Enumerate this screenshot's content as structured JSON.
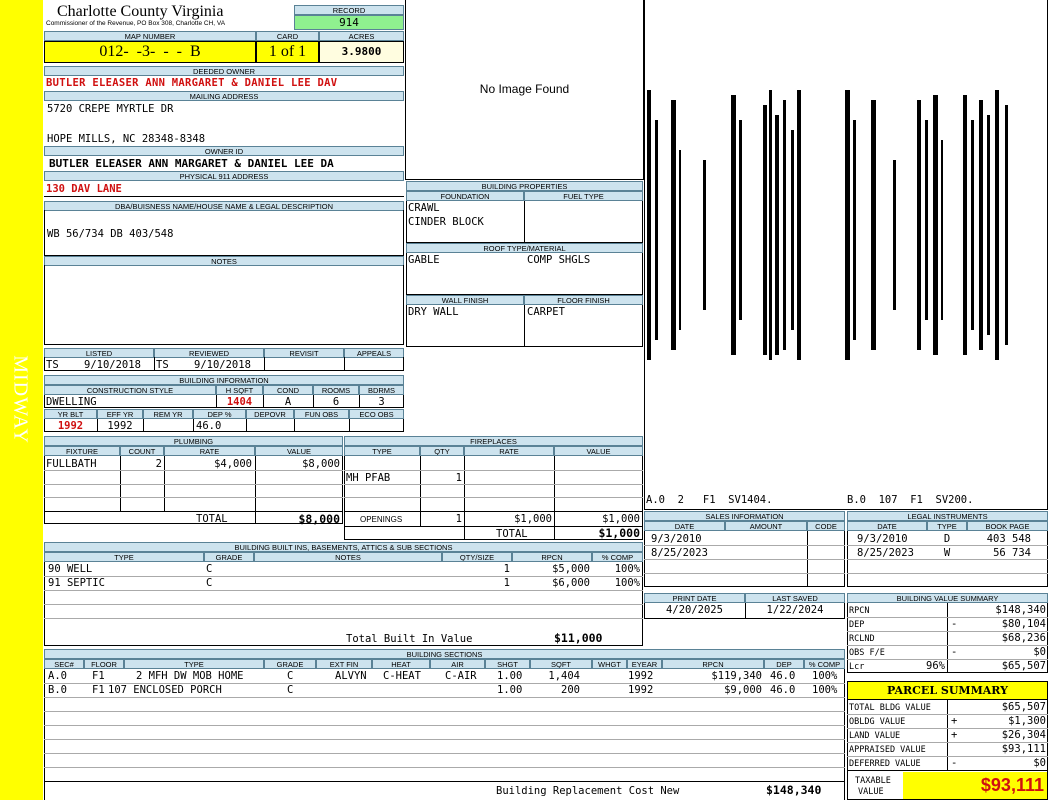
{
  "side_label": "MIDWAY",
  "county": {
    "title": "Charlotte County Virginia",
    "subtitle": "Commissioner of the Revenue, PO Box 308, Charlotte CH, VA"
  },
  "record": {
    "label": "RECORD",
    "value": "914"
  },
  "map": {
    "label": "MAP NUMBER",
    "value": "012-  -3-  -  -  B"
  },
  "card": {
    "label": "CARD",
    "value": "1 of 1"
  },
  "acres": {
    "label": "ACRES",
    "value": "3.9800"
  },
  "owner": {
    "label": "DEEDED OWNER",
    "value": "BUTLER ELEASER ANN MARGARET & DANIEL LEE DAV"
  },
  "mailing": {
    "label": "MAILING ADDRESS",
    "line1": "5720 CREPE MYRTLE DR",
    "line2": "HOPE MILLS, NC 28348-8348"
  },
  "owner_id": {
    "label": "OWNER ID",
    "value": "BUTLER ELEASER ANN MARGARET & DANIEL LEE DA"
  },
  "physical": {
    "label": "PHYSICAL 911 ADDRESS",
    "value": "130 DAV LANE"
  },
  "legal": {
    "label": "DBA/BUISNESS NAME/HOUSE NAME & LEGAL DESCRIPTION",
    "value": "WB 56/734 DB 403/548"
  },
  "notes": {
    "label": "NOTES"
  },
  "status": {
    "listed_label": "LISTED",
    "reviewed_label": "REVIEWED",
    "revisit_label": "REVISIT",
    "appeals_label": "APPEALS",
    "listed_by": "TS",
    "listed_date": "9/10/2018",
    "reviewed_by": "TS",
    "reviewed_date": "9/10/2018"
  },
  "building_info": {
    "label": "BUILDING INFORMATION",
    "h_style": "CONSTRUCTION STYLE",
    "h_sqft": "H SQFT",
    "h_cond": "COND",
    "h_rooms": "ROOMS",
    "h_bdrms": "BDRMS",
    "style": "DWELLING",
    "sqft": "1404",
    "cond": "A",
    "rooms": "6",
    "bdrms": "3",
    "h_yrblt": "YR BLT",
    "h_effyr": "EFF YR",
    "h_remyr": "REM YR",
    "h_dep": "DEP %",
    "h_depovr": "DEPOVR",
    "h_funobs": "FUN OBS",
    "h_ecoobs": "ECO OBS",
    "yrblt": "1992",
    "effyr": "1992",
    "dep": "46.0"
  },
  "photo": {
    "text": "No Image Found"
  },
  "building_props": {
    "label": "BUILDING PROPERTIES",
    "foundation_label": "FOUNDATION",
    "fuel_label": "FUEL TYPE",
    "foundation1": "CRAWL",
    "foundation2": "CINDER BLOCK",
    "roof_label": "ROOF TYPE/MATERIAL",
    "roof_type": "GABLE",
    "roof_mat": "COMP SHGLS",
    "wall_label": "WALL FINISH",
    "floor_label": "FLOOR FINISH",
    "wall": "DRY WALL",
    "floor": "CARPET"
  },
  "sketch": {
    "caption_a": "A.0  2   F1  SV1404.",
    "caption_b": "B.0  107  F1  SV200."
  },
  "plumbing": {
    "label": "PLUMBING",
    "h_fixture": "FIXTURE",
    "h_count": "COUNT",
    "h_rate": "RATE",
    "h_value": "VALUE",
    "fixture": "FULLBATH",
    "count": "2",
    "rate": "$4,000",
    "value": "$8,000",
    "total_label": "TOTAL",
    "total": "$8,000"
  },
  "fireplaces": {
    "label": "FIREPLACES",
    "h_type": "TYPE",
    "h_qty": "QTY",
    "h_rate": "RATE",
    "h_value": "VALUE",
    "type": "MH PFAB",
    "qty": "1",
    "openings_label": "OPENINGS",
    "openings_qty": "1",
    "openings_rate": "$1,000",
    "openings_value": "$1,000",
    "total_label": "TOTAL",
    "total": "$1,000"
  },
  "sales": {
    "label": "SALES INFORMATION",
    "h_date": "DATE",
    "h_amount": "AMOUNT",
    "h_code": "CODE",
    "rows": [
      {
        "date": "9/3/2010"
      },
      {
        "date": "8/25/2023"
      }
    ]
  },
  "instruments": {
    "label": "LEGAL INSTRUMENTS",
    "h_date": "DATE",
    "h_type": "TYPE",
    "h_book": "BOOK PAGE",
    "rows": [
      {
        "date": "9/3/2010",
        "type": "D",
        "book": "403 548"
      },
      {
        "date": "8/25/2023",
        "type": "W",
        "book": "56 734"
      }
    ]
  },
  "builtins": {
    "label": "BUILDING BUILT INS, BASEMENTS, ATTICS & SUB SECTIONS",
    "h_type": "TYPE",
    "h_grade": "GRADE",
    "h_notes": "NOTES",
    "h_qty": "QTY/SIZE",
    "h_rpcn": "RPCN",
    "h_comp": "% COMP",
    "rows": [
      {
        "type": "90 WELL",
        "grade": "C",
        "qty": "1",
        "rpcn": "$5,000",
        "comp": "100%"
      },
      {
        "type": "91 SEPTIC",
        "grade": "C",
        "qty": "1",
        "rpcn": "$6,000",
        "comp": "100%"
      }
    ],
    "total_label": "Total Built In Value",
    "total": "$11,000"
  },
  "dates": {
    "print_label": "PRINT DATE",
    "saved_label": "LAST SAVED",
    "print": "4/20/2025",
    "saved": "1/22/2024"
  },
  "value_summary": {
    "label": "BUILDING VALUE SUMMARY",
    "rpcn_label": "RPCN",
    "rpcn": "$148,340",
    "dep_label": "DEP",
    "dep_sign": "-",
    "dep": "$80,104",
    "rclnd_label": "RCLND",
    "rclnd": "$68,236",
    "obs_label": "OBS F/E",
    "obs_sign": "-",
    "obs": "$0",
    "lcr_label": "Lcr",
    "lcr_pct": "96%",
    "lcr": "$65,507"
  },
  "sections": {
    "label": "BUILDING SECTIONS",
    "h_sec": "SEC#",
    "h_floor": "FLOOR",
    "h_type": "TYPE",
    "h_grade": "GRADE",
    "h_extfin": "EXT FIN",
    "h_heat": "HEAT",
    "h_air": "AIR",
    "h_shgt": "SHGT",
    "h_sqft": "SQFT",
    "h_whgt": "WHGT",
    "h_eyear": "EYEAR",
    "h_rpcn": "RPCN",
    "h_dep": "DEP",
    "h_comp": "% COMP",
    "rows": [
      {
        "sec": "A.0",
        "floor": "F1",
        "type": "2 MFH DW MOB HOME",
        "grade": "C",
        "extfin": "ALVYN",
        "heat": "C-HEAT",
        "air": "C-AIR",
        "shgt": "1.00",
        "sqft": "1,404",
        "eyear": "1992",
        "rpcn": "$119,340",
        "dep": "46.0",
        "comp": "100%"
      },
      {
        "sec": "B.0",
        "floor": "F1",
        "type": "107 ENCLOSED PORCH",
        "grade": "C",
        "extfin": "",
        "heat": "",
        "air": "",
        "shgt": "1.00",
        "sqft": "200",
        "eyear": "1992",
        "rpcn": "$9,000",
        "dep": "46.0",
        "comp": "100%"
      }
    ],
    "total_label": "Building Replacement Cost New",
    "total": "$148,340"
  },
  "parcel": {
    "label": "PARCEL SUMMARY",
    "bldg_label": "TOTAL BLDG VALUE",
    "bldg": "$65,507",
    "obldg_label": "OBLDG VALUE",
    "obldg_sign": "+",
    "obldg": "$1,300",
    "land_label": "LAND VALUE",
    "land_sign": "+",
    "land": "$26,304",
    "appraised_label": "APPRAISED VALUE",
    "appraised": "$93,111",
    "deferred_label": "DEFERRED VALUE",
    "deferred_sign": "-",
    "deferred": "$0",
    "taxable_label1": "TAXABLE",
    "taxable_label2": "VALUE",
    "taxable": "$93,111"
  }
}
